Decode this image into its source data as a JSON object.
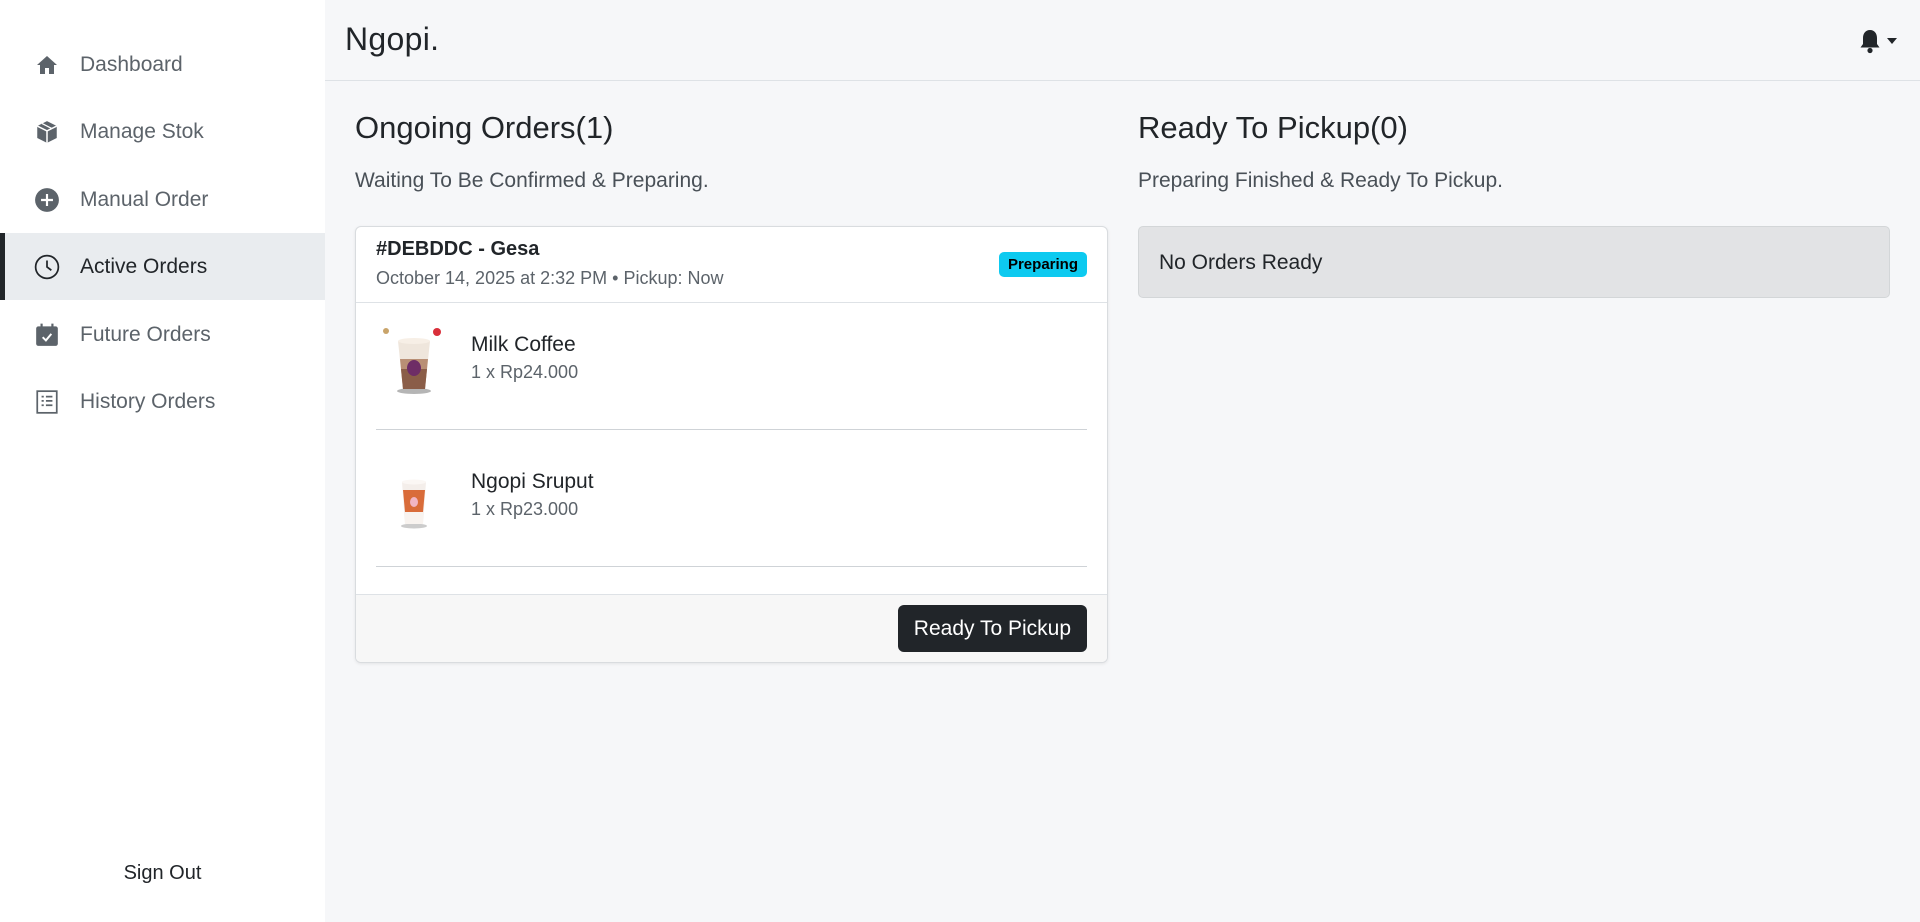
{
  "sidebar": {
    "items": [
      {
        "label": "Dashboard",
        "icon": "home-icon"
      },
      {
        "label": "Manage Stok",
        "icon": "box-icon"
      },
      {
        "label": "Manual Order",
        "icon": "plus-circle-icon"
      },
      {
        "label": "Active Orders",
        "icon": "clock-icon",
        "active": true
      },
      {
        "label": "Future Orders",
        "icon": "calendar-check-icon"
      },
      {
        "label": "History Orders",
        "icon": "receipt-icon"
      }
    ],
    "sign_out": "Sign Out"
  },
  "header": {
    "brand": "Ngopi.",
    "notification_icon": "bell-icon"
  },
  "ongoing": {
    "title": "Ongoing Orders(1)",
    "subtitle": "Waiting To Be Confirmed & Preparing.",
    "order": {
      "id": "#DEBDDC - Gesa",
      "meta": "October 14, 2025 at 2:32 PM • Pickup: Now",
      "status": "Preparing",
      "items": [
        {
          "name": "Milk Coffee",
          "price": "1 x Rp24.000"
        },
        {
          "name": "Ngopi Sruput",
          "price": "1 x Rp23.000"
        }
      ],
      "action": "Ready To Pickup"
    }
  },
  "ready": {
    "title": "Ready To Pickup(0)",
    "subtitle": "Preparing Finished & Ready To Pickup.",
    "empty": "No Orders Ready"
  },
  "colors": {
    "accent": "#212529",
    "badge": "#0dcaf0",
    "active_bg": "#e9ecef"
  }
}
